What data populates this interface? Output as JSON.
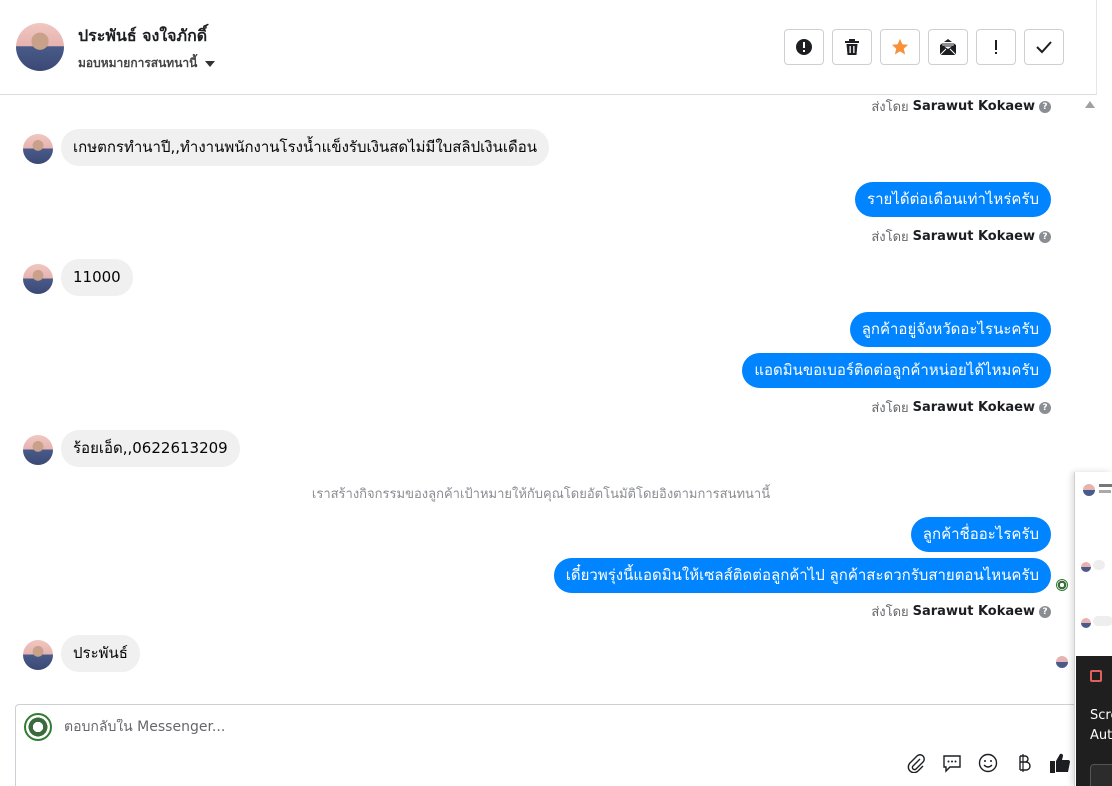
{
  "header": {
    "contact_name": "ประพันธ์ จงใจภักดิ์",
    "assign_label": "มอบหมายการสนทนานี้",
    "actions": [
      {
        "name": "spam-button",
        "icon": "alert-circle-icon"
      },
      {
        "name": "delete-button",
        "icon": "trash-icon"
      },
      {
        "name": "star-button",
        "icon": "star-icon"
      },
      {
        "name": "mark-unread-button",
        "icon": "envelope-open-icon"
      },
      {
        "name": "follow-up-button",
        "icon": "exclamation-icon"
      },
      {
        "name": "done-button",
        "icon": "check-icon"
      }
    ],
    "star_color": "#f7923a"
  },
  "thread": {
    "sent_by_prefix": "ส่งโดย",
    "agent_name": "Sarawut Kokaew",
    "messages": {
      "in_1": "เกษตกรทำนาปี,,ทำงานพนักงานโรงน้ำแข็งรับเงินสดไม่มีใบสลิปเงินเดือน",
      "out_1": "รายได้ต่อเดือนเท่าไหร่ครับ",
      "in_2": "11000",
      "out_2": "ลูกค้าอยู่จังหวัดอะไรนะครับ",
      "out_3": "แอดมินขอเบอร์ติดต่อลูกค้าหน่อยได้ไหมครับ",
      "in_3": "ร้อยเอ็ด,,0622613209",
      "system_note": "เราสร้างกิจกรรมของลูกค้าเป้าหมายให้กับคุณโดยอัตโนมัติโดยอิงตามการสนทนานี้",
      "out_4": "ลูกค้าชื่ออะไรครับ",
      "out_5": "เดี๋ยวพรุ่งนี้แอดมินให้เซลส์ติดต่อลูกค้าไป ลูกค้าสะดวกรับสายตอนไหนครับ",
      "in_4": "ประพันธ์"
    },
    "bubble_out_color": "#0084ff",
    "bubble_in_color": "#f0f0f0"
  },
  "composer": {
    "placeholder": "ตอบกลับใน Messenger...",
    "value": "",
    "tools": [
      "attach-icon",
      "saved-reply-icon",
      "emoji-icon",
      "baht-icon",
      "thumbs-up-icon"
    ]
  },
  "overlay": {
    "dark_line_1": "Scre",
    "dark_line_2": "Aut"
  }
}
